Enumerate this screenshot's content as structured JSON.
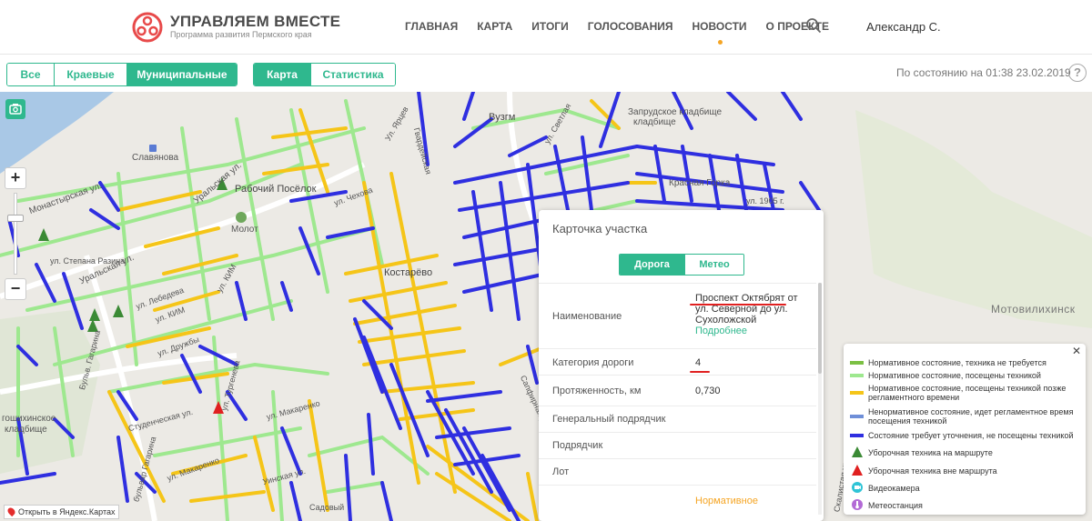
{
  "header": {
    "logo_title": "УПРАВЛЯЕМ ВМЕСТЕ",
    "logo_subtitle": "Программа развития Пермского края",
    "nav": [
      "ГЛАВНАЯ",
      "КАРТА",
      "ИТОГИ",
      "ГОЛОСОВАНИЯ",
      "НОВОСТИ",
      "О ПРОЕКТЕ"
    ],
    "active_nav": "НОВОСТИ",
    "user_name": "Александр С."
  },
  "toolbar": {
    "scope_tabs": [
      "Все",
      "Краевые",
      "Муниципальные"
    ],
    "scope_active": "Муниципальные",
    "view_tabs": [
      "Карта",
      "Статистика"
    ],
    "view_active": "Карта",
    "status": "По состоянию на 01:38 23.02.2019",
    "help": "?"
  },
  "map": {
    "labels": {
      "slavyanova": "Славянова",
      "rabochiy": "Рабочий Посёлок",
      "molot": "Молот",
      "kostarevo": "Костарёво",
      "vuzgorodok": "Вузгм",
      "zaprudskoe": "Запрудское кладбище",
      "kladbishche": "кладбище",
      "motovilikha": "Мотовилихинск",
      "gostinskoe": "гошихинское",
      "gostinskoe2": "кладбище",
      "uralskaya": "Уральская ул.",
      "uralskaya2": "Уральская ул.",
      "monastyrskaya": "Монастырская ул.",
      "stepana_razina": "ул. Степана Разина",
      "lebedeva": "ул. Лебедева",
      "kim": "ул. КИМ",
      "kim2": "ул. КИМ",
      "druzhby": "ул. Дружбы",
      "makarenko": "ул. Макаренко",
      "makarenko2": "ул. Макаренко",
      "bulvar_gagarina": "бульвар Гагарина",
      "bulvar_gagarina2": "Бульв. Гагарина",
      "uinskaya": "Уинская ул.",
      "turgeneva": "ул. Тургенева",
      "studencheskaya": "Студенческая ул.",
      "chekhova": "ул. Чехова",
      "sapfirnaya": "Сапфирная ул.",
      "skalistaya": "Скалистая ул.",
      "oktyabrya": "ул. 1905 г.",
      "krasnaya": "Красная Горка",
      "svetlaya": "ул. Светлая",
      "gvardeyskaya": "Гвардейская",
      "ocheredi": "Ул. Ярцев",
      "sadovy": "Садовый"
    },
    "open_in_yandex": "Открыть в Яндекс.Картах",
    "zoom_in": "+",
    "zoom_out": "−"
  },
  "card": {
    "title": "Карточка участка",
    "tabs": [
      "Дорога",
      "Метео"
    ],
    "tab_active": "Дорога",
    "rows": [
      {
        "label": "Наименование",
        "value": "Проспект Октябрят от ул. Северной до ул. Сухоложской",
        "link": "Подробнее"
      },
      {
        "label": "Категория дороги",
        "value": "4"
      },
      {
        "label": "Протяженность, км",
        "value": "0,730"
      },
      {
        "label": "Генеральный подрядчик",
        "value": ""
      },
      {
        "label": "Подрядчик",
        "value": ""
      },
      {
        "label": "Лот",
        "value": ""
      }
    ],
    "status": "Нормативное"
  },
  "legend": {
    "close": "✕",
    "items": [
      {
        "text": "Нормативное состояние, техника не требуется",
        "color": "#7bc043"
      },
      {
        "text": "Нормативное состояние, посещены техникой",
        "color": "#9ee88f"
      },
      {
        "text": "Нормативное состояние, посещены техникой позже регламентного времени",
        "color": "#f5c518"
      },
      {
        "text": "Ненормативное состояние, идет регламентное время посещения техникой",
        "color": "#6f8fd8"
      },
      {
        "text": "Состояние требует уточнения, не посещены техникой",
        "color": "#2f2fe0"
      },
      {
        "text": "Уборочная техника на маршруте",
        "icon": "green-arrow-icon"
      },
      {
        "text": "Уборочная техника вне маршрута",
        "icon": "red-arrow-icon"
      },
      {
        "text": "Видеокамера",
        "icon": "camera-icon"
      },
      {
        "text": "Метеостанция",
        "icon": "thermometer-icon"
      }
    ]
  },
  "colors": {
    "accent": "#2fb88e",
    "road_blue": "#2f2fe0",
    "road_yellow": "#f5c518",
    "road_green": "#9ee88f",
    "water": "#a9c8e6",
    "alert_red": "#e02020"
  }
}
